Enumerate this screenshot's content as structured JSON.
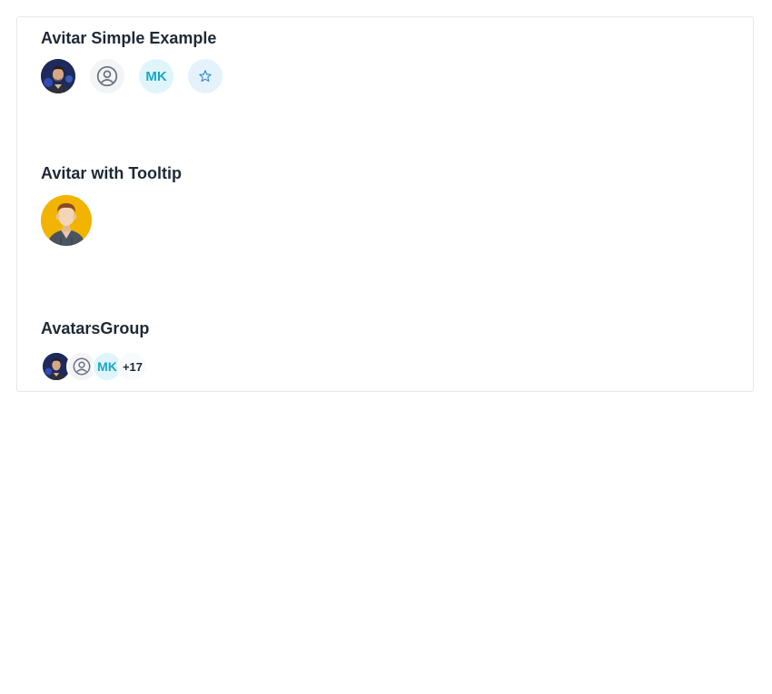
{
  "sections": {
    "simple": {
      "title": "Avitar Simple Example",
      "initials": "MK"
    },
    "tooltip": {
      "title": "Avitar with Tooltip"
    },
    "group": {
      "title": "AvatarsGroup",
      "initials": "MK",
      "more_count": "+17"
    }
  },
  "colors": {
    "initials_bg": "#dff5fb",
    "initials_text": "#19a7c4",
    "tooltip_avatar_bg": "#f2b400",
    "border": "#e5e7eb"
  }
}
